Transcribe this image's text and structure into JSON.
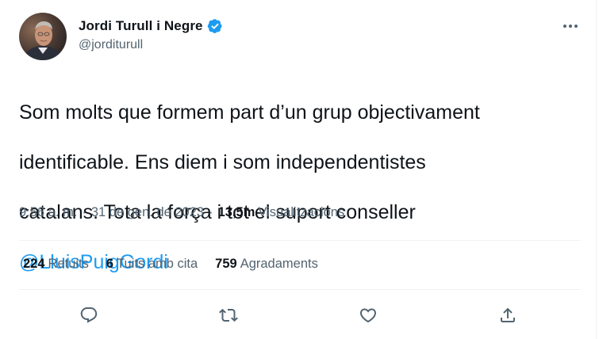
{
  "author": {
    "display_name": "Jordi Turull i Negre",
    "handle": "@jorditurull",
    "verified": true,
    "verified_color": "#1d9bf0"
  },
  "tweet": {
    "text_lines": [
      "Som molts que formem part d’un grup objectivament",
      "identificable. Ens diem i som independentistes",
      "catalans. Tota la força i tot el suport conseller"
    ],
    "mention": "@LluisPuigGordi",
    "time": "9:56 a. m.",
    "date": "31 de gen. de 2023",
    "separator": "·",
    "views_count": "13,5m",
    "views_label": "Visualitzacions"
  },
  "stats": {
    "retweets": {
      "count": "224",
      "label": "Retuits"
    },
    "quotes": {
      "count": "6",
      "label": "Tuits amb cita"
    },
    "likes": {
      "count": "759",
      "label": "Agradaments"
    }
  },
  "actions": [
    "reply-icon",
    "retweet-icon",
    "like-icon",
    "share-icon"
  ],
  "colors": {
    "text": "#0f1419",
    "secondary": "#536471",
    "link": "#1d9bf0",
    "divider": "#eff3f4"
  }
}
